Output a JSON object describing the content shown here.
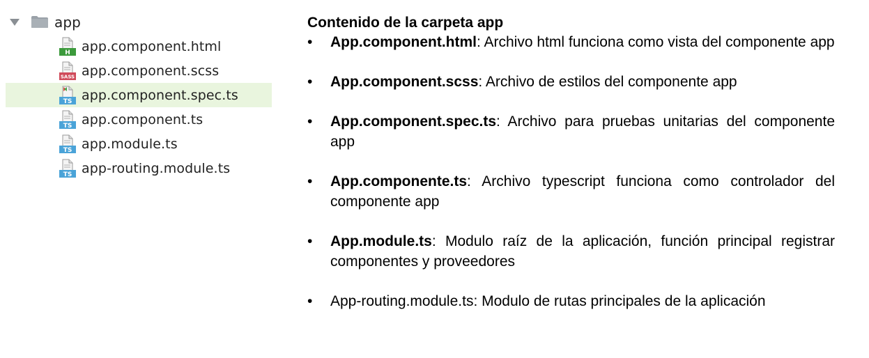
{
  "tree": {
    "root": {
      "label": "app",
      "icon": "folder-icon",
      "expanded": true
    },
    "files": [
      {
        "label": "app.component.html",
        "icon": "html-file-icon",
        "badge": "H",
        "badge_color": "#3c9a3c",
        "selected": false
      },
      {
        "label": "app.component.scss",
        "icon": "sass-file-icon",
        "badge": "SASS",
        "badge_color": "#d04b5b",
        "selected": false
      },
      {
        "label": "app.component.spec.ts",
        "icon": "ts-spec-file-icon",
        "badge": "TS",
        "badge_color": "#4aa3d8",
        "selected": true
      },
      {
        "label": "app.component.ts",
        "icon": "ts-file-icon",
        "badge": "TS",
        "badge_color": "#4aa3d8",
        "selected": false
      },
      {
        "label": "app.module.ts",
        "icon": "ts-file-icon",
        "badge": "TS",
        "badge_color": "#4aa3d8",
        "selected": false
      },
      {
        "label": "app-routing.module.ts",
        "icon": "ts-file-icon",
        "badge": "TS",
        "badge_color": "#4aa3d8",
        "selected": false
      }
    ],
    "selected_row_color": "#e9f5de"
  },
  "description": {
    "title": "Contenido de la carpeta app",
    "bullet": "•",
    "items": [
      {
        "name": "App.component.html",
        "text": ": Archivo html funciona como vista del componente app"
      },
      {
        "name": "App.component.scss",
        "text": ": Archivo de estilos del componente app"
      },
      {
        "name": "App.component.spec.ts",
        "text": ": Archivo para pruebas unitarias del componente app"
      },
      {
        "name": "App.componente.ts",
        "text": ": Archivo typescript funciona como controlador del componente app"
      },
      {
        "name": "App.module.ts",
        "text": ": Modulo raíz de la aplicación, función principal registrar componentes y proveedores"
      },
      {
        "name": "App-routing.module.ts",
        "text": ": Modulo de rutas principales de la aplicación"
      }
    ]
  }
}
